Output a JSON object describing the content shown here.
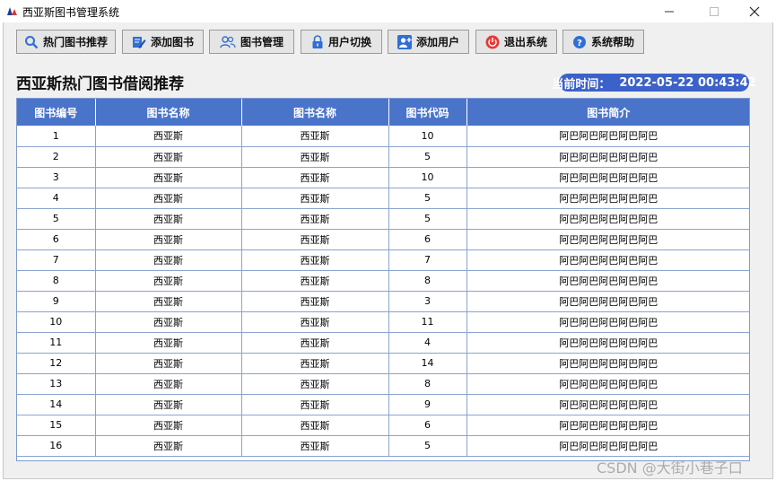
{
  "window": {
    "title": "西亚斯图书管理系统"
  },
  "toolbar": [
    {
      "label": "热门图书推荐",
      "icon": "search-icon"
    },
    {
      "label": "添加图书",
      "icon": "edit-icon"
    },
    {
      "label": "图书管理",
      "icon": "users-icon"
    },
    {
      "label": "用户切换",
      "icon": "lock-icon"
    },
    {
      "label": "添加用户",
      "icon": "add-user-icon"
    },
    {
      "label": "退出系统",
      "icon": "power-icon"
    },
    {
      "label": "系统帮助",
      "icon": "help-icon"
    }
  ],
  "page": {
    "heading": "西亚斯热门图书借阅推荐",
    "time_label": "当前时间：",
    "time_value": "2022-05-22 00:43:42"
  },
  "table": {
    "columns": [
      "图书编号",
      "图书名称",
      "图书名称",
      "图书代码",
      "图书简介"
    ],
    "rows": [
      [
        "1",
        "西亚斯",
        "西亚斯",
        "10",
        "阿巴阿巴阿巴阿巴阿巴"
      ],
      [
        "2",
        "西亚斯",
        "西亚斯",
        "5",
        "阿巴阿巴阿巴阿巴阿巴"
      ],
      [
        "3",
        "西亚斯",
        "西亚斯",
        "10",
        "阿巴阿巴阿巴阿巴阿巴"
      ],
      [
        "4",
        "西亚斯",
        "西亚斯",
        "5",
        "阿巴阿巴阿巴阿巴阿巴"
      ],
      [
        "5",
        "西亚斯",
        "西亚斯",
        "5",
        "阿巴阿巴阿巴阿巴阿巴"
      ],
      [
        "6",
        "西亚斯",
        "西亚斯",
        "6",
        "阿巴阿巴阿巴阿巴阿巴"
      ],
      [
        "7",
        "西亚斯",
        "西亚斯",
        "7",
        "阿巴阿巴阿巴阿巴阿巴"
      ],
      [
        "8",
        "西亚斯",
        "西亚斯",
        "8",
        "阿巴阿巴阿巴阿巴阿巴"
      ],
      [
        "9",
        "西亚斯",
        "西亚斯",
        "3",
        "阿巴阿巴阿巴阿巴阿巴"
      ],
      [
        "10",
        "西亚斯",
        "西亚斯",
        "11",
        "阿巴阿巴阿巴阿巴阿巴"
      ],
      [
        "11",
        "西亚斯",
        "西亚斯",
        "4",
        "阿巴阿巴阿巴阿巴阿巴"
      ],
      [
        "12",
        "西亚斯",
        "西亚斯",
        "14",
        "阿巴阿巴阿巴阿巴阿巴"
      ],
      [
        "13",
        "西亚斯",
        "西亚斯",
        "8",
        "阿巴阿巴阿巴阿巴阿巴"
      ],
      [
        "14",
        "西亚斯",
        "西亚斯",
        "9",
        "阿巴阿巴阿巴阿巴阿巴"
      ],
      [
        "15",
        "西亚斯",
        "西亚斯",
        "6",
        "阿巴阿巴阿巴阿巴阿巴"
      ],
      [
        "16",
        "西亚斯",
        "西亚斯",
        "5",
        "阿巴阿巴阿巴阿巴阿巴"
      ]
    ]
  },
  "watermark": "CSDN @大街小巷子口",
  "colors": {
    "header_blue": "#4a74c9",
    "badge_blue": "#3c62c9",
    "power_red": "#e53935",
    "icon_blue": "#2f6fd6"
  }
}
